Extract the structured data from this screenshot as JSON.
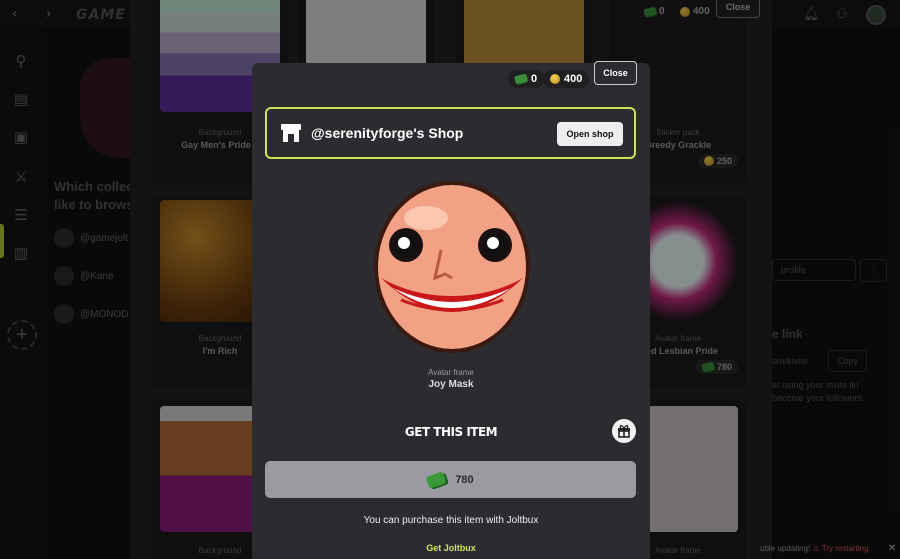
{
  "topbar": {
    "logo": "GAME",
    "back_icon": "chevron-left-icon",
    "forward_icon": "chevron-right-icon"
  },
  "background_page": {
    "title": "Which collec like to brows",
    "users": [
      "@gamejolt",
      "@Kane",
      "@MONOD"
    ],
    "right_panel": {
      "profile_btn": "profile",
      "invite_heading": "e link",
      "invite_url": "om/invite",
      "copy_label": "Copy",
      "invite_desc_1": "et using your invite lin",
      "invite_desc_2": "become your followers."
    },
    "toast": {
      "text": "uble updating!",
      "action": "Try restarting"
    }
  },
  "shop_dialog": {
    "balance_joltbux": "0",
    "balance_coins": "400",
    "close_label": "Close",
    "cards": [
      {
        "category": "Background",
        "name": "Gay Men's Pride F"
      },
      {
        "category": "Sticker pack",
        "name": "Greedy Grackle",
        "price": "250"
      },
      {
        "category": "Background",
        "name": "I'm Rich"
      },
      {
        "category": "Avatar frame",
        "name": "ated Lesbian Pride",
        "price": "780"
      },
      {
        "category": "Background",
        "name": ""
      },
      {
        "category": "Avatar frame",
        "name": ""
      }
    ]
  },
  "item_modal": {
    "balance_joltbux": "0",
    "balance_coins": "400",
    "close_label": "Close",
    "shop_title": "@serenityforge's Shop",
    "open_shop_label": "Open shop",
    "item_category": "Avatar frame",
    "item_name": "Joy Mask",
    "get_title": "GET THIS ITEM",
    "price": "780",
    "purchase_note": "You can purchase this item with Joltbux",
    "get_joltbux_label": "Get Joltbux"
  },
  "colors": {
    "accent": "#cfe35a",
    "modal_bg": "#2c2b30",
    "buy_button": "#9a9aa0"
  }
}
